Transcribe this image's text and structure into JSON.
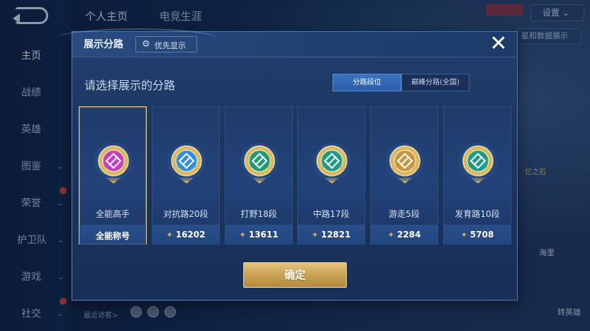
{
  "background": {
    "nav_items": [
      {
        "label": "主页",
        "active": true,
        "has_chevron": false
      },
      {
        "label": "战绩",
        "active": false,
        "has_chevron": false
      },
      {
        "label": "英雄",
        "active": false,
        "has_chevron": false
      },
      {
        "label": "图鉴",
        "active": false,
        "has_chevron": true
      },
      {
        "label": "荣誉",
        "active": false,
        "has_chevron": true
      },
      {
        "label": "护卫队",
        "active": false,
        "has_chevron": true
      },
      {
        "label": "游戏",
        "active": false,
        "has_chevron": true
      },
      {
        "label": "社交",
        "active": false,
        "has_chevron": true
      }
    ],
    "tabs": [
      "个人主页",
      "电竞生涯"
    ],
    "settings_label": "设置",
    "chip_label": "星和数据展示",
    "hero_label": "忆之石",
    "bottom_label_1": "海里",
    "bottom_label_2": "转英雄",
    "visitors_label": "最近访客>"
  },
  "modal": {
    "title": "展示分路",
    "priority_label": "优先显示",
    "subtitle": "请选择展示的分路",
    "segments": [
      "分路段位",
      "巅峰分路(全国)"
    ],
    "active_segment": 0,
    "confirm_label": "确定",
    "cards": [
      {
        "name": "全能高手",
        "value": "全能称号",
        "show_star": false,
        "selected": true,
        "emblem": "all-round-emblem-icon",
        "color": "#c53fbf"
      },
      {
        "name": "对抗路20段",
        "value": "16202",
        "show_star": true,
        "selected": false,
        "emblem": "clash-lane-emblem-icon",
        "color": "#2f8fe0"
      },
      {
        "name": "打野18段",
        "value": "13611",
        "show_star": true,
        "selected": false,
        "emblem": "jungle-emblem-icon",
        "color": "#1f9a74"
      },
      {
        "name": "中路17段",
        "value": "12821",
        "show_star": true,
        "selected": false,
        "emblem": "mid-lane-emblem-icon",
        "color": "#1f9a86"
      },
      {
        "name": "游走5段",
        "value": "2284",
        "show_star": true,
        "selected": false,
        "emblem": "roam-emblem-icon",
        "color": "#c9963f"
      },
      {
        "name": "发育路10段",
        "value": "5708",
        "show_star": true,
        "selected": false,
        "emblem": "farm-lane-emblem-icon",
        "color": "#1f9a86"
      }
    ]
  }
}
